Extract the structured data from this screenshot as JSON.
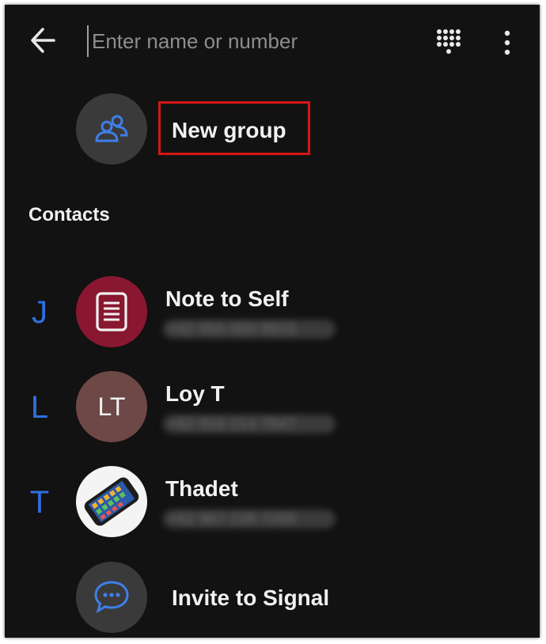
{
  "search": {
    "placeholder": "Enter name or number"
  },
  "new_group": {
    "label": "New group"
  },
  "section": {
    "title": "Contacts"
  },
  "contacts": [
    {
      "letter": "J",
      "name": "Note to Self",
      "number": "+62 955 000 8833",
      "avatar": "note-icon",
      "avatar_color": "#8a1730"
    },
    {
      "letter": "L",
      "name": "Loy T",
      "number": "+62 916 214 7847",
      "initials": "LT",
      "avatar_color": "#6e4747"
    },
    {
      "letter": "T",
      "name": "Thadet",
      "number": "+62 967 238 7200",
      "avatar": "phone-photo"
    }
  ],
  "invite": {
    "label": "Invite to Signal"
  },
  "colors": {
    "background": "#121212",
    "accent": "#2f6fe0",
    "highlight": "#d61616",
    "icon_circle": "#3a3a3a"
  }
}
